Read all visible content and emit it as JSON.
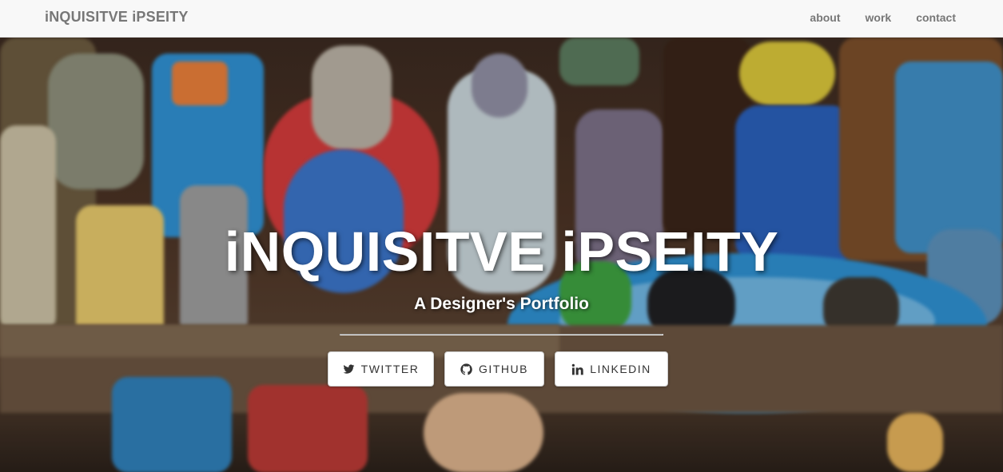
{
  "navbar": {
    "brand": "iNQUISITVE iPSEITY",
    "links": [
      {
        "label": "about"
      },
      {
        "label": "work"
      },
      {
        "label": "contact"
      }
    ]
  },
  "hero": {
    "title": "iNQUISITVE iPSEITY",
    "subtitle": "A Designer's Portfolio",
    "buttons": [
      {
        "label": "TWITTER",
        "icon": "twitter-icon"
      },
      {
        "label": "GITHUB",
        "icon": "github-icon"
      },
      {
        "label": "LINKEDIN",
        "icon": "linkedin-icon"
      }
    ]
  },
  "colors": {
    "navbar_bg": "#f8f8f8",
    "navbar_text": "#777777",
    "hero_text": "#ffffff",
    "button_bg": "#ffffff",
    "button_text": "#333333"
  }
}
